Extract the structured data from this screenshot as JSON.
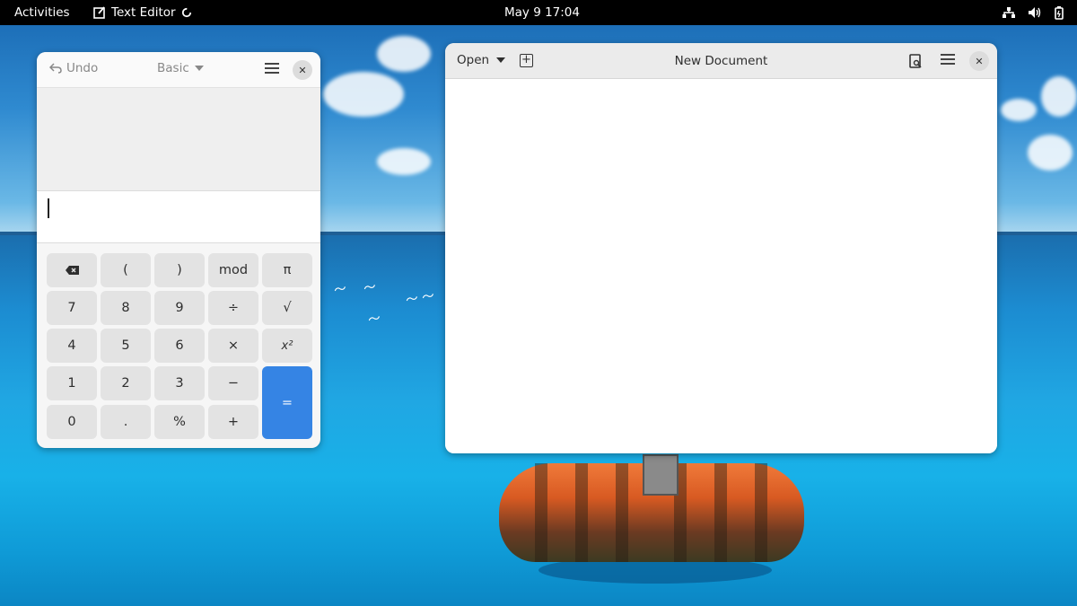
{
  "topbar": {
    "activities": "Activities",
    "app_name": "Text Editor",
    "clock": "May 9  17:04"
  },
  "calculator": {
    "undo_label": "Undo",
    "mode_label": "Basic",
    "keys": {
      "backspace": "⌫",
      "lparen": "(",
      "rparen": ")",
      "mod": "mod",
      "pi": "π",
      "k7": "7",
      "k8": "8",
      "k9": "9",
      "divide": "÷",
      "sqrt": "√",
      "k4": "4",
      "k5": "5",
      "k6": "6",
      "multiply": "×",
      "square": "x²",
      "k1": "1",
      "k2": "2",
      "k3": "3",
      "minus": "−",
      "equals": "=",
      "k0": "0",
      "decimal": ".",
      "percent": "%",
      "plus": "+"
    }
  },
  "editor": {
    "open_label": "Open",
    "document_title": "New Document"
  },
  "colors": {
    "accent": "#3584e4",
    "topbar": "#000000",
    "headerbar": "#ebebeb"
  }
}
